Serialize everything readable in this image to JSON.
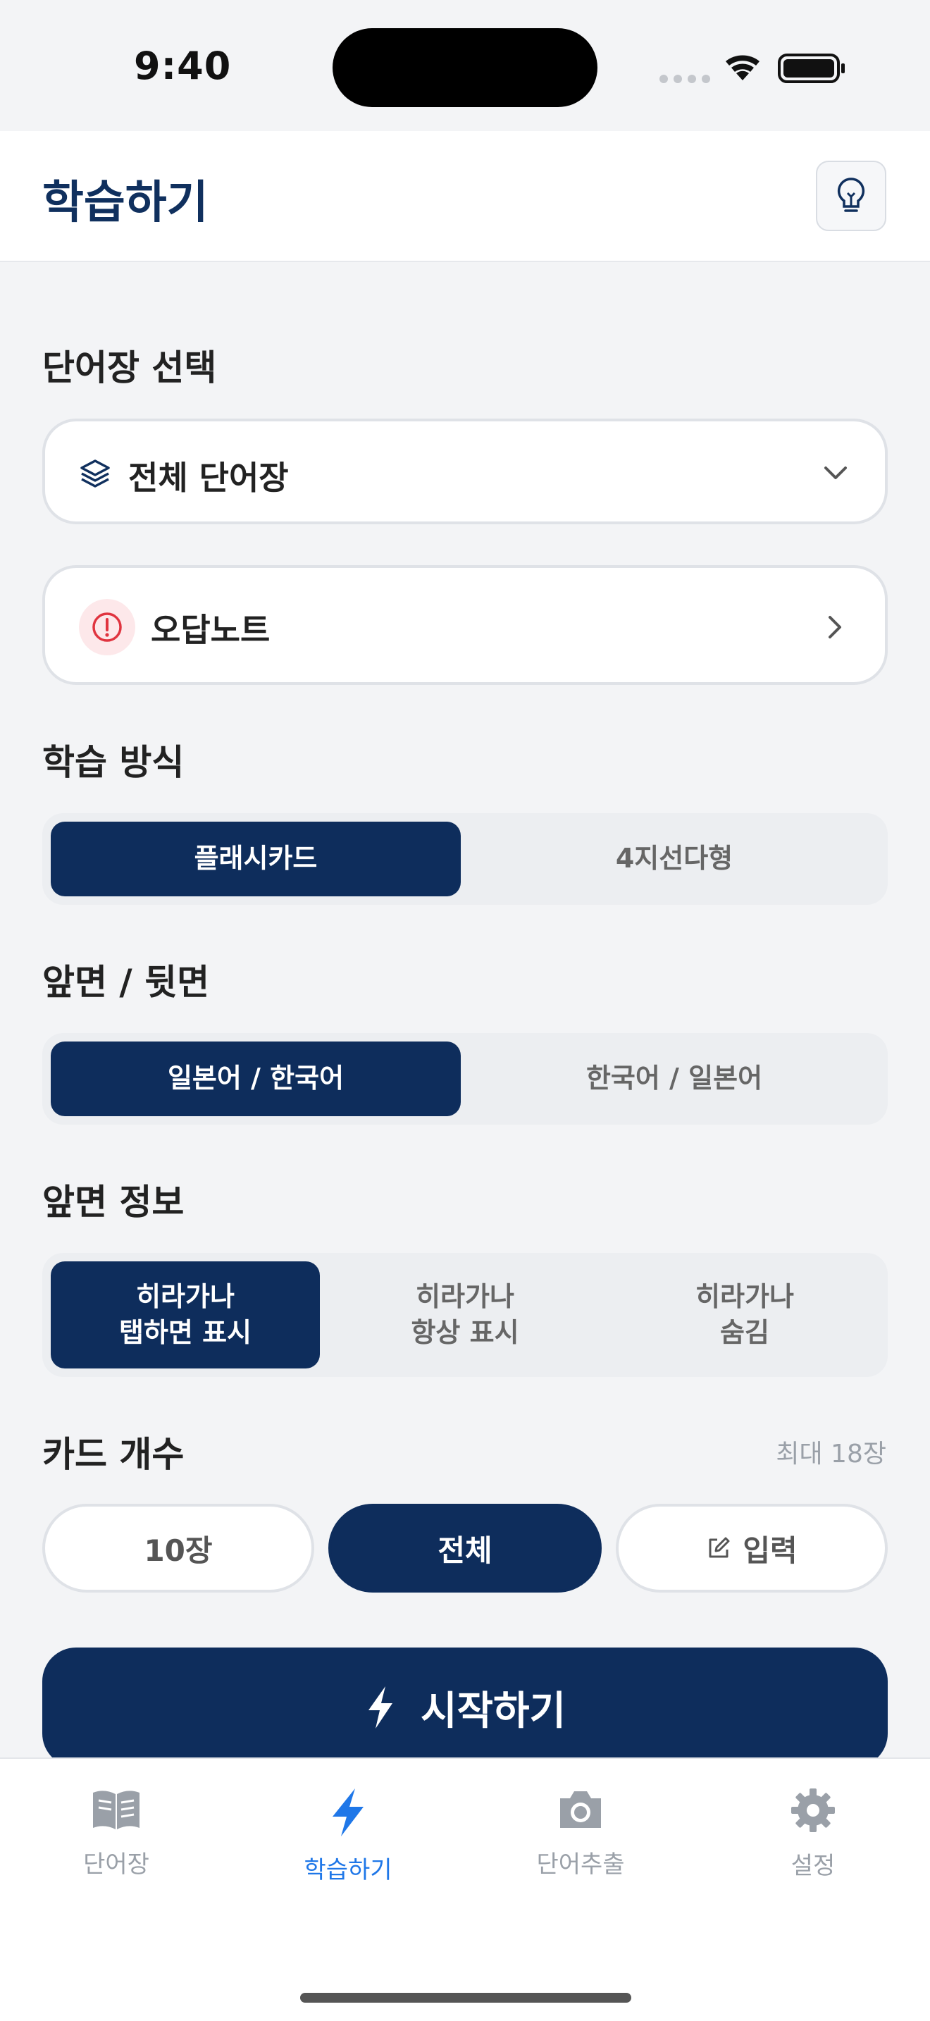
{
  "status": {
    "time": "9:40"
  },
  "header": {
    "title": "학습하기",
    "hint_icon": "lightbulb-icon"
  },
  "deck": {
    "label": "단어장 선택",
    "selected": "전체 단어장",
    "wrong_note": "오답노트"
  },
  "mode": {
    "label": "학습 방식",
    "options": [
      "플래시카드",
      "4지선다형"
    ],
    "selected": 0
  },
  "face": {
    "label": "앞면 / 뒷면",
    "options": [
      "일본어 / 한국어",
      "한국어 / 일본어"
    ],
    "selected": 0
  },
  "front_info": {
    "label": "앞면 정보",
    "options": [
      {
        "line1": "히라가나",
        "line2": "탭하면 표시"
      },
      {
        "line1": "히라가나",
        "line2": "항상 표시"
      },
      {
        "line1": "히라가나",
        "line2": "숨김"
      }
    ],
    "selected": 0
  },
  "card_count": {
    "label": "카드 개수",
    "max": "최대 18장",
    "options": [
      "10장",
      "전체",
      "입력"
    ],
    "selected": 1
  },
  "start_button": "시작하기",
  "tabs": [
    {
      "label": "단어장",
      "icon": "book-icon"
    },
    {
      "label": "학습하기",
      "icon": "bolt-icon"
    },
    {
      "label": "단어추출",
      "icon": "camera-icon"
    },
    {
      "label": "설정",
      "icon": "gear-icon"
    }
  ],
  "colors": {
    "primary": "#0e2d5c",
    "accent": "#1f77e8",
    "danger": "#e0343f"
  }
}
